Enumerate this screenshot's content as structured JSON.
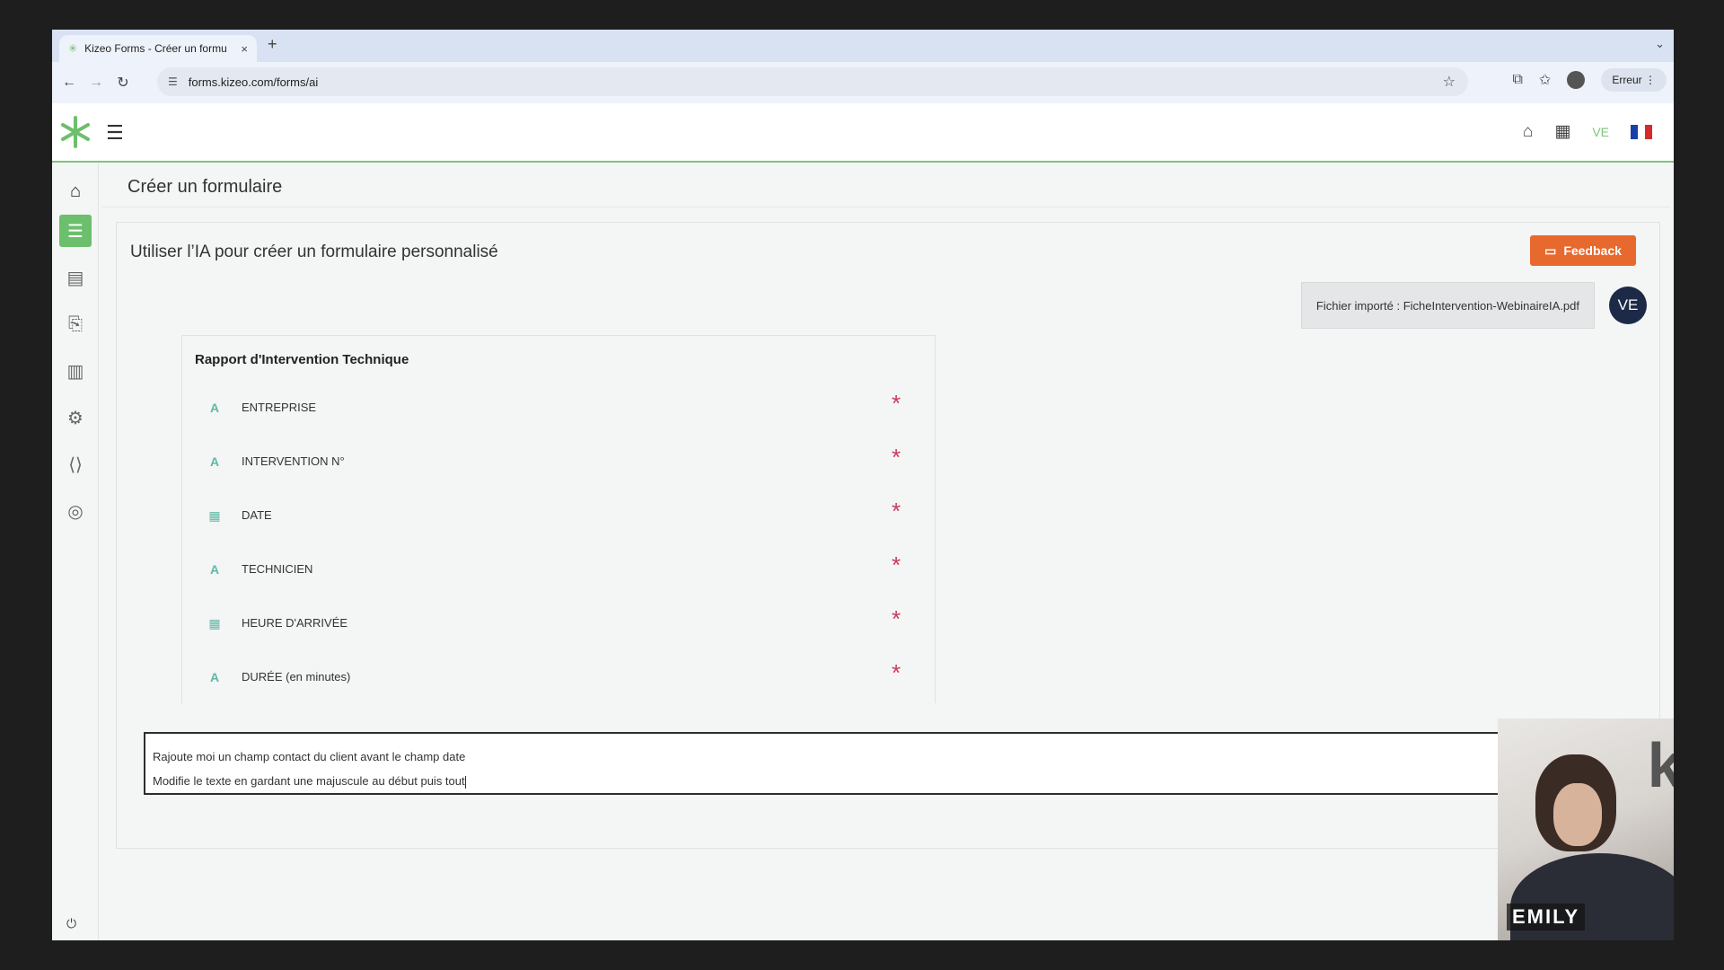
{
  "browser": {
    "tab_title": "Kizeo Forms - Créer un formu",
    "tab_close": "×",
    "new_tab": "+",
    "url": "forms.kizeo.com/forms/ai",
    "profile_status": "Erreur"
  },
  "header": {
    "user_initials": "VE",
    "icons": [
      "menu-icon",
      "basket-icon",
      "apps-grid-icon",
      "france-flag-icon"
    ]
  },
  "sidebar": {
    "items": [
      "home-icon",
      "form-list-icon",
      "data-list-icon",
      "document-search-icon",
      "stats-icon",
      "settings-icon",
      "code-icon",
      "user-icon"
    ],
    "active_index": 1
  },
  "page": {
    "title": "Créer un formulaire",
    "card_title": "Utiliser l’IA pour créer un formulaire personnalisé",
    "feedback_label": "Feedback"
  },
  "chat": {
    "imported_file": "Fichier importé : FicheIntervention-WebinaireIA.pdf",
    "avatar": "VE"
  },
  "form": {
    "name": "Rapport d'Intervention Technique",
    "fields": [
      {
        "icon": "A",
        "type": "text",
        "label": "ENTREPRISE",
        "required": "*"
      },
      {
        "icon": "A",
        "type": "text",
        "label": "INTERVENTION N°",
        "required": "*"
      },
      {
        "icon": "▦",
        "type": "date",
        "label": "DATE",
        "required": "*"
      },
      {
        "icon": "A",
        "type": "text",
        "label": "TECHNICIEN",
        "required": "*"
      },
      {
        "icon": "▦",
        "type": "date",
        "label": "HEURE D'ARRIVÉE",
        "required": "*"
      },
      {
        "icon": "A",
        "type": "text",
        "label": "DURÉE (en minutes)",
        "required": "*"
      }
    ]
  },
  "prompt": {
    "line1": "Rajoute moi un champ contact du client avant le champ date",
    "line2": "Modifie le texte en gardant une majuscule au début puis tout"
  },
  "webcam": {
    "name": "EMILY",
    "logo_text": "kiz"
  },
  "colors": {
    "brand_green": "#6cbf6c",
    "feedback_orange": "#e8692e",
    "required_red": "#cc3a5a",
    "field_icon_teal": "#5fb8a6",
    "avatar_navy": "#1c2a47"
  }
}
